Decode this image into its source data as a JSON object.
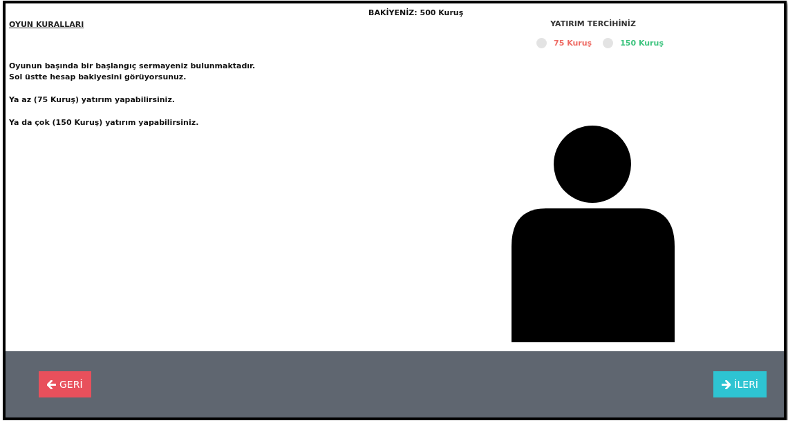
{
  "balance": "BAKİYENİZ: 500 Kuruş",
  "rules": {
    "title": "OYUN KURALLARI",
    "paragraphs": [
      [
        "Oyunun başında bir başlangıç sermayeniz bulunmaktadır.",
        "Sol üstte hesap bakiyesini görüyorsunuz."
      ],
      [
        "Ya az (75 Kuruş) yatırım yapabilirsiniz."
      ],
      [
        "Ya da çok (150 Kuruş) yatırım yapabilirsiniz."
      ]
    ]
  },
  "choice": {
    "title": "YATIRIM TERCİHİNİZ",
    "options": [
      {
        "label": "75 Kuruş",
        "color": "#ee6b64",
        "selected": false
      },
      {
        "label": "150 Kuruş",
        "color": "#3ec47f",
        "selected": false
      }
    ]
  },
  "buttons": [
    {
      "label": "GERİ",
      "kind": "back"
    },
    {
      "label": "İLERİ",
      "kind": "next"
    }
  ]
}
